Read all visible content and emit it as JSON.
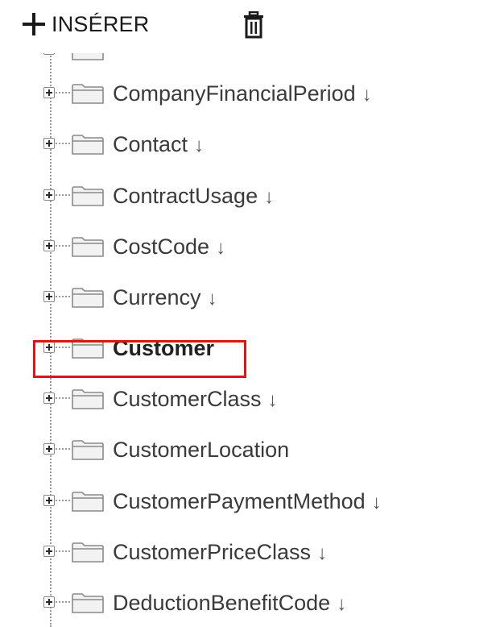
{
  "toolbar": {
    "insert_label": "INSÉRER",
    "insert_icon": "plus-icon",
    "delete_icon": "trash-icon"
  },
  "tree": {
    "items": [
      {
        "label": "CompanyFinancialPeriod",
        "sort_indicator": "↓",
        "bold": false
      },
      {
        "label": "Contact",
        "sort_indicator": "↓",
        "bold": false
      },
      {
        "label": "ContractUsage",
        "sort_indicator": "↓",
        "bold": false
      },
      {
        "label": "CostCode",
        "sort_indicator": "↓",
        "bold": false
      },
      {
        "label": "Currency",
        "sort_indicator": "↓",
        "bold": false
      },
      {
        "label": "Customer",
        "sort_indicator": "",
        "bold": true,
        "highlighted": true
      },
      {
        "label": "CustomerClass",
        "sort_indicator": "↓",
        "bold": false
      },
      {
        "label": "CustomerLocation",
        "sort_indicator": "",
        "bold": false
      },
      {
        "label": "CustomerPaymentMethod",
        "sort_indicator": "↓",
        "bold": false
      },
      {
        "label": "CustomerPriceClass",
        "sort_indicator": "↓",
        "bold": false
      },
      {
        "label": "DeductionBenefitCode",
        "sort_indicator": "↓",
        "bold": false
      }
    ]
  },
  "colors": {
    "highlight_border": "#d9161c",
    "folder_fill": "#f2f2f2",
    "folder_stroke": "#8a8a8a",
    "tree_line": "#9a9a9a"
  }
}
